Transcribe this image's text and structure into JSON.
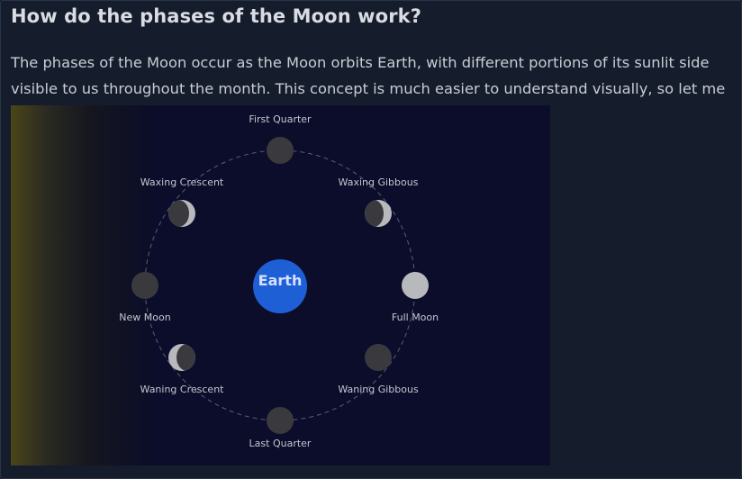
{
  "title": "How do the phases of the Moon work?",
  "intro": "The phases of the Moon occur as the Moon orbits Earth, with different portions of its sunlit side visible to us throughout the month. This concept is much easier to understand visually, so let me show you:",
  "diagram": {
    "earth_label": "Earth",
    "phases": {
      "first_quarter": "First Quarter",
      "waxing_gibbous": "Waxing Gibbous",
      "full_moon": "Full Moon",
      "waning_gibbous": "Waning Gibbous",
      "last_quarter": "Last Quarter",
      "waning_crescent": "Waning Crescent",
      "new_moon": "New Moon",
      "waxing_crescent": "Waxing Crescent"
    },
    "colors": {
      "background": "#0b0d2a",
      "earth": "#1f5fd6",
      "moon_dark": "#3a3a3e",
      "moon_lit": "#b8b9bd",
      "sunlight": "#4a4518"
    }
  }
}
